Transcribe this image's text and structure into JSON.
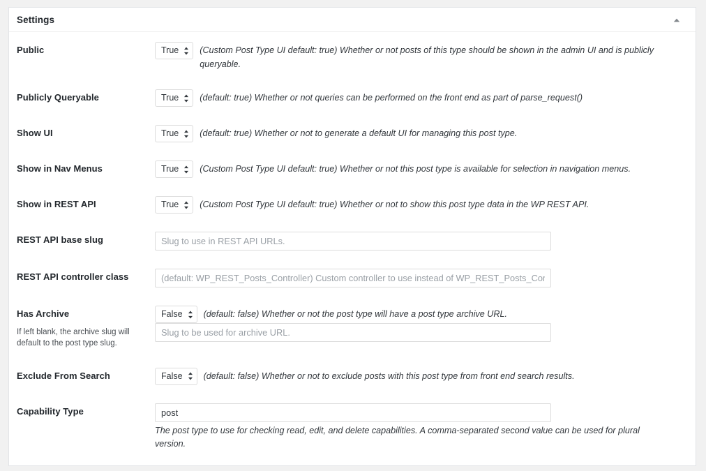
{
  "panel": {
    "title": "Settings",
    "toggle_icon": "chevron-up-icon"
  },
  "fields": {
    "public": {
      "label": "Public",
      "value": "True",
      "description": "(Custom Post Type UI default: true) Whether or not posts of this type should be shown in the admin UI and is publicly queryable."
    },
    "publicly_queryable": {
      "label": "Publicly Queryable",
      "value": "True",
      "description": "(default: true) Whether or not queries can be performed on the front end as part of parse_request()"
    },
    "show_ui": {
      "label": "Show UI",
      "value": "True",
      "description": "(default: true) Whether or not to generate a default UI for managing this post type."
    },
    "show_in_nav_menus": {
      "label": "Show in Nav Menus",
      "value": "True",
      "description": "(Custom Post Type UI default: true) Whether or not this post type is available for selection in navigation menus."
    },
    "show_in_rest": {
      "label": "Show in REST API",
      "value": "True",
      "description": "(Custom Post Type UI default: true) Whether or not to show this post type data in the WP REST API."
    },
    "rest_base": {
      "label": "REST API base slug",
      "value": "",
      "placeholder": "Slug to use in REST API URLs."
    },
    "rest_controller_class": {
      "label": "REST API controller class",
      "value": "",
      "placeholder": "(default: WP_REST_Posts_Controller) Custom controller to use instead of WP_REST_Posts_Controller."
    },
    "has_archive": {
      "label": "Has Archive",
      "sublabel": "If left blank, the archive slug will default to the post type slug.",
      "value": "False",
      "description": "(default: false) Whether or not the post type will have a post type archive URL.",
      "slug_value": "",
      "slug_placeholder": "Slug to be used for archive URL."
    },
    "exclude_from_search": {
      "label": "Exclude From Search",
      "value": "False",
      "description": "(default: false) Whether or not to exclude posts with this post type from front end search results."
    },
    "capability_type": {
      "label": "Capability Type",
      "value": "post",
      "description": "The post type to use for checking read, edit, and delete capabilities. A comma-separated second value can be used for plural version."
    }
  },
  "select_options": [
    "True",
    "False"
  ]
}
